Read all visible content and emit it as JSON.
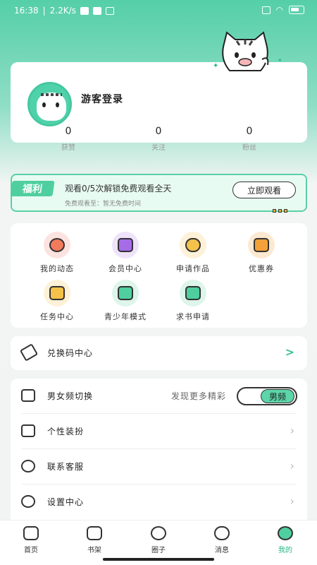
{
  "status_bar": {
    "time": "16:38",
    "speed": "2.2K/s"
  },
  "profile": {
    "guest_login": "游客登录",
    "stats": [
      {
        "value": "0",
        "label": "获赞"
      },
      {
        "value": "0",
        "label": "关注"
      },
      {
        "value": "0",
        "label": "粉丝"
      }
    ]
  },
  "welfare": {
    "tag": "福利",
    "title": "观看0/5次解锁免费观看全天",
    "subtitle": "免费观看至：暂无免费时间",
    "button": "立即观看"
  },
  "grid": [
    {
      "label": "我的动态",
      "icon": "dynamic-icon",
      "color": "#fde3e0"
    },
    {
      "label": "会员中心",
      "icon": "vip-diamond-icon",
      "color": "#efe3fb"
    },
    {
      "label": "申请作品",
      "icon": "upload-cloud-icon",
      "color": "#fdf1d8"
    },
    {
      "label": "优惠券",
      "icon": "coupon-icon",
      "color": "#fde9d2"
    },
    {
      "label": "任务中心",
      "icon": "task-calendar-icon",
      "color": "#fdf1d8"
    },
    {
      "label": "青少年模式",
      "icon": "graduation-cap-icon",
      "color": "#ddf5ea"
    },
    {
      "label": "求书申请",
      "icon": "book-request-icon",
      "color": "#ddf5ea"
    }
  ],
  "redeem": {
    "label": "兑换码中心"
  },
  "list": {
    "gender": {
      "label": "男女频切换",
      "hint": "发现更多精彩",
      "toggle": "男频"
    },
    "items": [
      {
        "label": "个性装扮",
        "icon": "dress-icon"
      },
      {
        "label": "联系客服",
        "icon": "headset-icon"
      },
      {
        "label": "设置中心",
        "icon": "settings-icon"
      }
    ]
  },
  "tabs": [
    {
      "label": "首页",
      "icon": "home-icon"
    },
    {
      "label": "书架",
      "icon": "bookshelf-icon"
    },
    {
      "label": "圈子",
      "icon": "circle-icon"
    },
    {
      "label": "消息",
      "icon": "message-icon"
    },
    {
      "label": "我的",
      "icon": "profile-icon",
      "active": true
    }
  ],
  "colors": {
    "accent": "#4fcf9f",
    "active_tab": "#2bb584"
  }
}
